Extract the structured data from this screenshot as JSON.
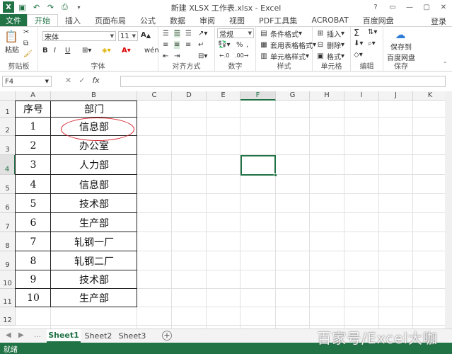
{
  "window": {
    "title": "新建 XLSX 工作表.xlsx - Excel",
    "controls": [
      "?",
      "▭",
      "—",
      "▢",
      "✕"
    ]
  },
  "tabs": {
    "file": "文件",
    "items": [
      "开始",
      "插入",
      "页面布局",
      "公式",
      "数据",
      "审阅",
      "视图",
      "PDF工具集",
      "ACROBAT",
      "百度网盘"
    ],
    "active": "开始",
    "login": "登录"
  },
  "ribbon": {
    "clipboard": {
      "label": "剪贴板",
      "paste": "粘贴"
    },
    "font": {
      "label": "字体",
      "name": "宋体",
      "size": "11",
      "bold": "B",
      "italic": "I",
      "underline": "U"
    },
    "align": {
      "label": "对齐方式"
    },
    "number": {
      "label": "数字",
      "format": "常规",
      "percent": "%"
    },
    "styles": {
      "label": "样式",
      "cond": "条件格式",
      "table": "套用表格格式",
      "cell": "单元格样式"
    },
    "cells": {
      "label": "单元格",
      "insert": "插入",
      "delete": "删除",
      "format": "格式"
    },
    "edit": {
      "label": "编辑",
      "sum": "Σ"
    },
    "save": {
      "label": "保存",
      "line1": "保存到",
      "line2": "百度网盘"
    }
  },
  "formula": {
    "namebox": "F4",
    "cancel": "✕",
    "enter": "✓",
    "fx": "fx",
    "value": ""
  },
  "columns": [
    "A",
    "B",
    "C",
    "D",
    "E",
    "F",
    "G",
    "H",
    "I",
    "J",
    "K"
  ],
  "selected_column": "F",
  "selected_row": "4",
  "rows": [
    "1",
    "2",
    "3",
    "4",
    "5",
    "6",
    "7",
    "8",
    "9",
    "10",
    "11",
    "12"
  ],
  "table": {
    "header": {
      "a": "序号",
      "b": "部门"
    },
    "data": [
      {
        "a": "1",
        "b": "信息部"
      },
      {
        "a": "2",
        "b": "办公室"
      },
      {
        "a": "3",
        "b": "人力部"
      },
      {
        "a": "4",
        "b": "信息部"
      },
      {
        "a": "5",
        "b": "技术部"
      },
      {
        "a": "6",
        "b": "生产部"
      },
      {
        "a": "7",
        "b": "轧钢一厂"
      },
      {
        "a": "8",
        "b": "轧钢二厂"
      },
      {
        "a": "9",
        "b": "技术部"
      },
      {
        "a": "10",
        "b": "生产部"
      }
    ]
  },
  "sheets": {
    "items": [
      "Sheet1",
      "Sheet2",
      "Sheet3"
    ],
    "active": "Sheet1",
    "add": "+"
  },
  "status": {
    "text": "就绪"
  },
  "watermark": "百家号/Excel大咖"
}
